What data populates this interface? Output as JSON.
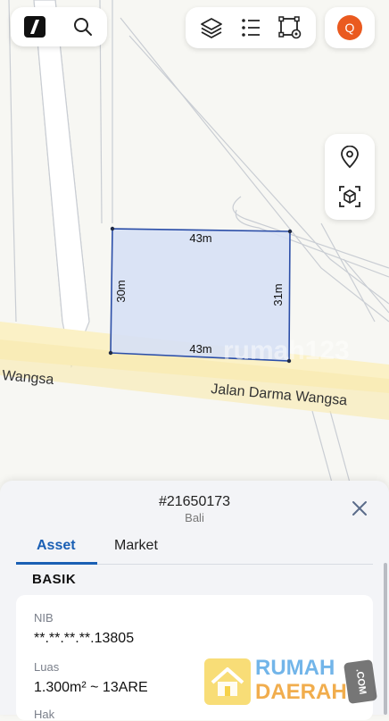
{
  "map": {
    "street_name_left": "Wangsa",
    "street_name_main": "Jalan Darma Wangsa",
    "parcel": {
      "top_edge": "43m",
      "bottom_edge": "43m",
      "left_edge": "30m",
      "right_edge": "31m"
    },
    "faint_watermark": "rumah123",
    "colors": {
      "parcel_fill": "#d6e0f5",
      "parcel_stroke": "#2b4ea8",
      "road_fill": "#fbf1c6",
      "accent": "#1a5fb4"
    }
  },
  "toolbar": {
    "logo_icon": "app-logo-icon",
    "search_icon": "search-icon",
    "layers_icon": "layers-icon",
    "list_icon": "list-icon",
    "polygon_tool_icon": "polygon-settings-icon",
    "avatar_letter": "Q",
    "avatar_color": "#ea5a1f"
  },
  "side_tools": {
    "location_icon": "location-pin-icon",
    "ar_icon": "ar-cube-icon"
  },
  "panel": {
    "property_id": "#21650173",
    "region": "Bali",
    "tabs": [
      {
        "label": "Asset",
        "active": true
      },
      {
        "label": "Market",
        "active": false
      }
    ],
    "section_title": "BASIK",
    "fields": [
      {
        "label": "NIB",
        "value": "**.**.**.**.13805"
      },
      {
        "label": "Luas",
        "value": "1.300m² ~ 13ARE"
      },
      {
        "label": "Hak",
        "value": ""
      }
    ]
  },
  "watermark": {
    "line1": "RUMAH",
    "line2": "DAERAH",
    "tag": ".COM"
  }
}
